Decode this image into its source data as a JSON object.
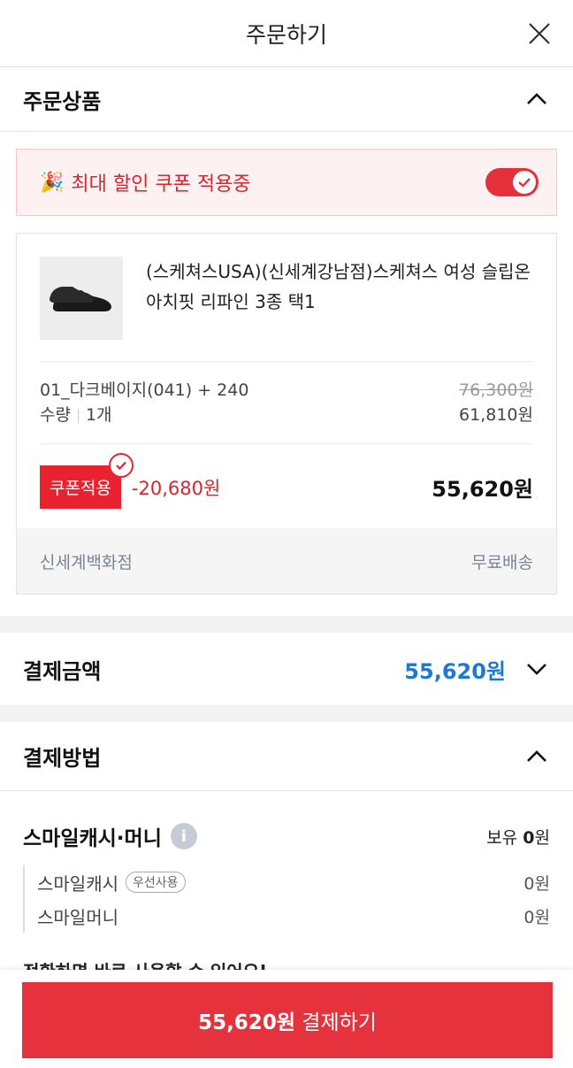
{
  "header": {
    "title": "주문하기",
    "close_icon": "close-icon"
  },
  "order_section": {
    "title": "주문상품"
  },
  "coupon_banner": {
    "emoji": "🎉",
    "text": "최대 할인 쿠폰 적용중",
    "toggle_on": true
  },
  "product": {
    "name": "(스케쳐스USA)(신세계강남점)스케쳐스 여성 슬립온 아치핏 리파인 3종 택1",
    "option": "01_다크베이지(041) + 240",
    "original_price": "76,300원",
    "qty_label": "수량",
    "qty_value": "1개",
    "price": "61,810원",
    "coupon_label": "쿠폰적용",
    "discount": "-20,680원",
    "final_price": "55,620원",
    "seller": "신세계백화점",
    "shipping": "무료배송"
  },
  "payment_amount": {
    "label": "결제금액",
    "amount": "55,620원"
  },
  "payment_method": {
    "title": "결제방법",
    "cash_title": "스마일캐시·머니",
    "own_label": "보유",
    "own_value": "0",
    "own_unit": "원",
    "items": [
      {
        "label": "스마일캐시",
        "pill": "우선사용",
        "value": "0원"
      },
      {
        "label": "스마일머니",
        "value": "0원"
      }
    ],
    "cut_text": "전환하면 바로 사용할 수 있어요!"
  },
  "pay_button": {
    "amount": "55,620원",
    "label": "결제하기"
  },
  "colors": {
    "accent_red": "#e6323c",
    "accent_blue": "#1e78d2"
  }
}
